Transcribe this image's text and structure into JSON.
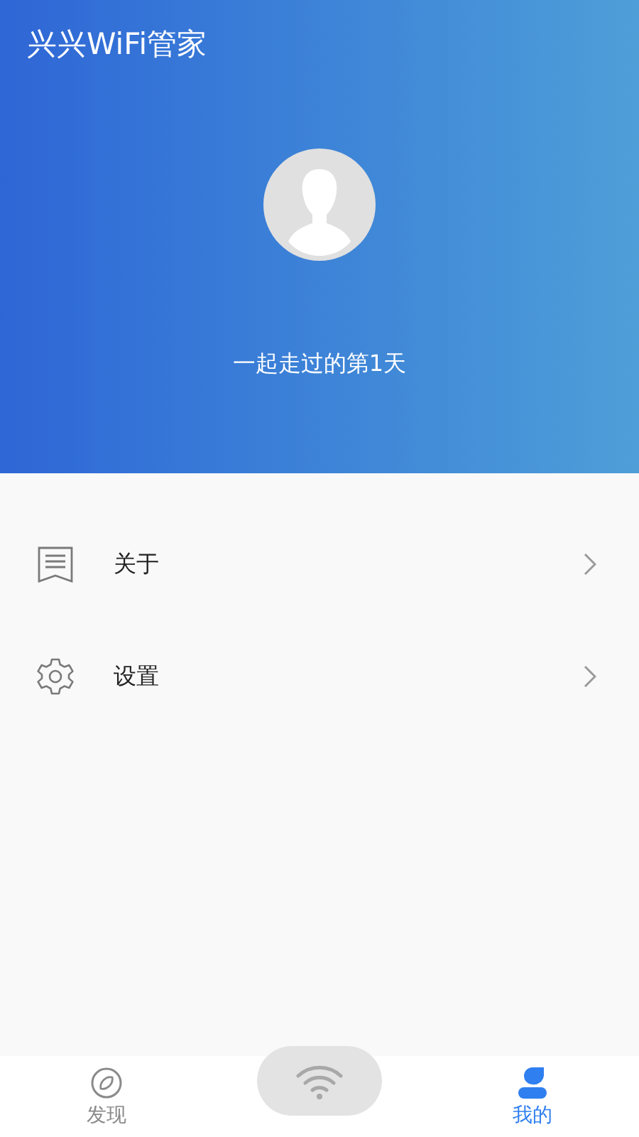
{
  "header": {
    "title": "兴兴WiFi管家",
    "subtitle": "一起走过的第1天"
  },
  "menu": [
    {
      "kind": "about",
      "label": "关于"
    },
    {
      "kind": "settings",
      "label": "设置"
    }
  ],
  "tabs": [
    {
      "kind": "discover",
      "label": "发现",
      "selected": false
    },
    {
      "kind": "mine",
      "label": "我的",
      "selected": true
    }
  ]
}
